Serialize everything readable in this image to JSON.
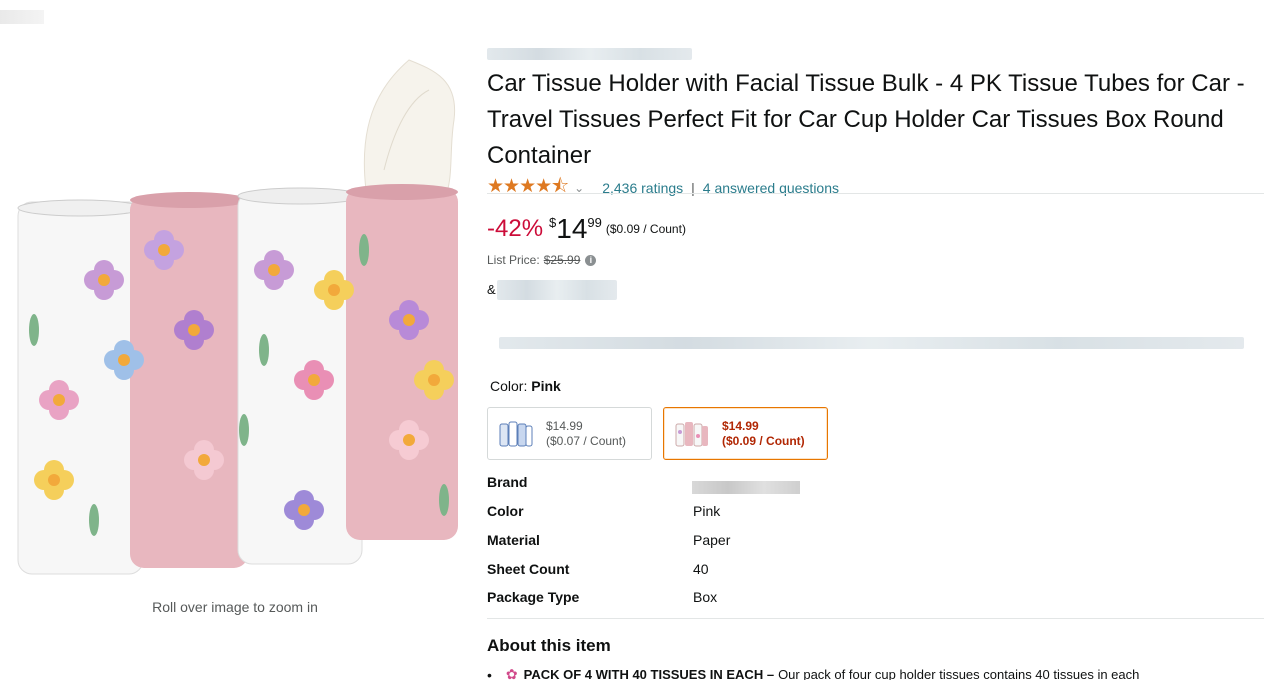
{
  "product": {
    "title": "Car Tissue Holder with Facial Tissue Bulk - 4 PK Tissue Tubes for Car - Travel Tissues Perfect Fit for Car Cup Holder Car Tissues Box Round Container",
    "rating_stars": 4.5,
    "stars_glyphs": "★★★★⯪",
    "ratings_count": "2,436 ratings",
    "answered_questions": "4 answered questions",
    "separator": "|"
  },
  "image": {
    "zoom_hint": "Roll over image to zoom in"
  },
  "price": {
    "discount": "-42%",
    "currency": "$",
    "whole": "14",
    "fraction": "99",
    "unit_price": "($0.09 / Count)",
    "list_price_label": "List Price:",
    "list_price": "$25.99",
    "ampersand": "&"
  },
  "color": {
    "label": "Color:",
    "selected": "Pink",
    "options": [
      {
        "price": "$14.99",
        "unit": "($0.07 / Count)",
        "selected": false
      },
      {
        "price": "$14.99",
        "unit": "($0.09 / Count)",
        "selected": true
      }
    ]
  },
  "specs": [
    {
      "key": "Brand",
      "value": ""
    },
    {
      "key": "Color",
      "value": "Pink"
    },
    {
      "key": "Material",
      "value": "Paper"
    },
    {
      "key": "Sheet Count",
      "value": "40"
    },
    {
      "key": "Package Type",
      "value": "Box"
    }
  ],
  "about": {
    "heading": "About this item",
    "bullet_bold": "PACK OF 4 WITH 40 TISSUES IN EACH –",
    "bullet_text": "Our pack of four cup holder tissues contains 40 tissues in each"
  },
  "colors": {
    "link": "#2a7c8c",
    "discount": "#cc0c39",
    "star": "#de7921",
    "selected_border": "#e77600",
    "selected_price": "#b12704"
  }
}
